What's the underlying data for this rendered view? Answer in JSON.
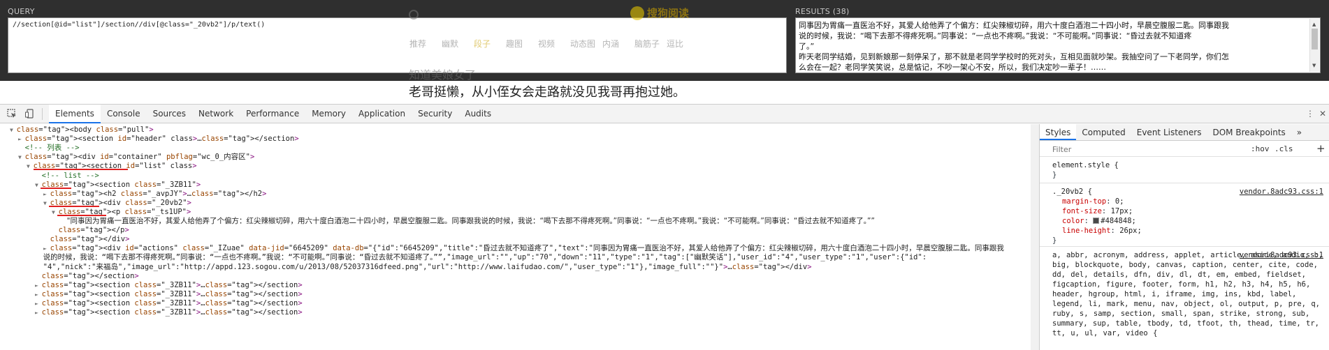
{
  "xpath_helper": {
    "query_label": "QUERY",
    "query": "//section[@id=\"list\"]/section//div[@class=\"_20vb2\"]/p/text()",
    "results_label": "RESULTS (38)",
    "results_lines": [
      "同事因为胃痛一直医治不好，其爱人给他弄了个偏方：红尖辣椒切碎，用六十度白酒泡二十四小时，早晨空腹服二匙。同事跟我",
      "说的时候，我说：“喝下去那不得疼死啊。”同事说：“一点也不疼啊。”我说：“不可能啊。”同事说：“昏过去就不知道疼",
      "了。”",
      "昨天老同学结婚，见到新娘那一刻停呆了，那不就是老同学学校时的死对头，互相见面就吵架。我抽空问了一下老同学，你们怎",
      "么会在一起？老同学笑笑说，总是惦记，不吵一架心不安，所以，我们决定吵一辈子！……"
    ]
  },
  "background_page": {
    "logo_text": "搜狗阅读",
    "nav": [
      "推荐",
      "幽默",
      "段子",
      "趣图",
      "视频",
      "动态图",
      "内涵",
      "脑筋子",
      "逗比"
    ],
    "active_nav_index": 2,
    "headline": "知道美娘女了",
    "snippet": "老哥挺懒，从小侄女会走路就没见我哥再抱过她。"
  },
  "devtools": {
    "tabs": [
      "Elements",
      "Console",
      "Sources",
      "Network",
      "Performance",
      "Memory",
      "Application",
      "Security",
      "Audits"
    ],
    "active_tab": "Elements",
    "dom_lines": [
      {
        "indent": 0,
        "arrow": "▼",
        "html": "<body class=\"pull\">"
      },
      {
        "indent": 1,
        "arrow": "►",
        "html": "<section id=\"header\" class>…</section>"
      },
      {
        "indent": 1,
        "arrow": "",
        "comment": "<!-- 列表 -->"
      },
      {
        "indent": 1,
        "arrow": "▼",
        "html": "<div id=\"container\" pbflag=\"wc_0_内容区\">"
      },
      {
        "indent": 2,
        "arrow": "▼",
        "html": "<section id=\"list\" class>"
      },
      {
        "indent": 3,
        "arrow": "",
        "comment": "<!-- list -->"
      },
      {
        "indent": 3,
        "arrow": "▼",
        "html": "<section class=\"_3ZB11\">"
      },
      {
        "indent": 4,
        "arrow": "►",
        "html": "<h2 class=\"_avpJY\">…</h2>"
      },
      {
        "indent": 4,
        "arrow": "▼",
        "html": "<div class=\"_20vb2\">"
      },
      {
        "indent": 5,
        "arrow": "▼",
        "html": "<p class=\"_ts1UP\">"
      },
      {
        "indent": 6,
        "arrow": "",
        "text": "\"同事因为胃痛一直医治不好，其爱人给他弄了个偏方：红尖辣椒切碎，用六十度白酒泡二十四小时，早晨空腹服二匙。同事跟我说的时候，我说：“喝下去那不得疼死啊。”同事说：“一点也不疼啊。”我说：“不可能啊。”同事说：“昏过去就不知道疼了。””"
      },
      {
        "indent": 5,
        "arrow": "",
        "html": "</p>"
      },
      {
        "indent": 4,
        "arrow": "",
        "html": "</div>"
      },
      {
        "indent": 4,
        "arrow": "►",
        "html": "<div id=\"actions\" class=\"_IZuae\" data-jid=\"6645209\" data-db=\"{\"id\":\"6645209\",\"title\":\"昏过去就不知道疼了\",\"text\":\"同事因为胃痛一直医治不好，其爱人给他弄了个偏方：红尖辣椒切碎，用六十度白酒泡二十四小时，早晨空腹服二匙。同事跟我"
      },
      {
        "indent": 0,
        "arrow": "",
        "html": "说的时候，我说：“喝下去那不得疼死啊。”同事说：“一点也不疼啊。”我说：“不可能啊。”同事说：“昏过去就不知道疼了。””,\"image_url\":\"\",\"up\":\"70\",\"down\":\"11\",\"type\":\"1\",\"tag\":[\"幽默笑话\"],\"user_id\":\"4\",\"user_type\":\"1\",\"user\":{\"id\":"
      },
      {
        "indent": 0,
        "arrow": "",
        "html": "\"4\",\"nick\":\"来福岛\",\"image_url\":\"http://appd.123.sogou.com/u/2013/08/52037316dfeed.png\",\"url\":\"http://www.laifudao.com/\",\"user_type\":\"1\"},\"image_full\":\"\"}\">…</div>"
      },
      {
        "indent": 3,
        "arrow": "",
        "html": "</section>"
      },
      {
        "indent": 3,
        "arrow": "►",
        "html": "<section class=\"_3ZB11\">…</section>"
      },
      {
        "indent": 3,
        "arrow": "►",
        "html": "<section class=\"_3ZB11\">…</section>"
      },
      {
        "indent": 3,
        "arrow": "►",
        "html": "<section class=\"_3ZB11\">…</section>"
      },
      {
        "indent": 3,
        "arrow": "►",
        "html": "<section class=\"_3ZB11\">…</section>"
      }
    ],
    "styles_tabs": [
      "Styles",
      "Computed",
      "Event Listeners",
      "DOM Breakpoints"
    ],
    "styles_more": "»",
    "filter_placeholder": "Filter",
    "hov_label": ":hov",
    "cls_label": ".cls",
    "add_label": "+",
    "element_style": {
      "selector": "element.style {",
      "close": "}"
    },
    "rule_1": {
      "selector": "._20vb2 {",
      "source": "vendor.8adc93.css:1",
      "props": [
        {
          "name": "margin-top",
          "value": "0;"
        },
        {
          "name": "font-size",
          "value": "17px;"
        },
        {
          "name": "color",
          "value": "#484848;",
          "swatch": "#484848"
        },
        {
          "name": "line-height",
          "value": "26px;"
        }
      ],
      "close": "}"
    },
    "rule_2": {
      "selectors": "a, abbr, acronym, address, applet, article, aside, audio, b, big, blockquote, body, canvas, caption, center, cite, code, dd, del, details, dfn, div, dl, dt, em, embed, fieldset, figcaption, figure, footer, form, h1, h2, h3, h4, h5, h6, header, hgroup, html, i, iframe, img, ins, kbd, label, legend, li, mark, menu, nav, object, ol, output, p, pre, q, ruby, s, samp, section, small, span, strike, strong, sub, summary, sup, table, tbody, td, tfoot, th, thead, time, tr, tt, u, ul, var, video {",
      "source": "vendor.8adc93.css:1"
    }
  }
}
